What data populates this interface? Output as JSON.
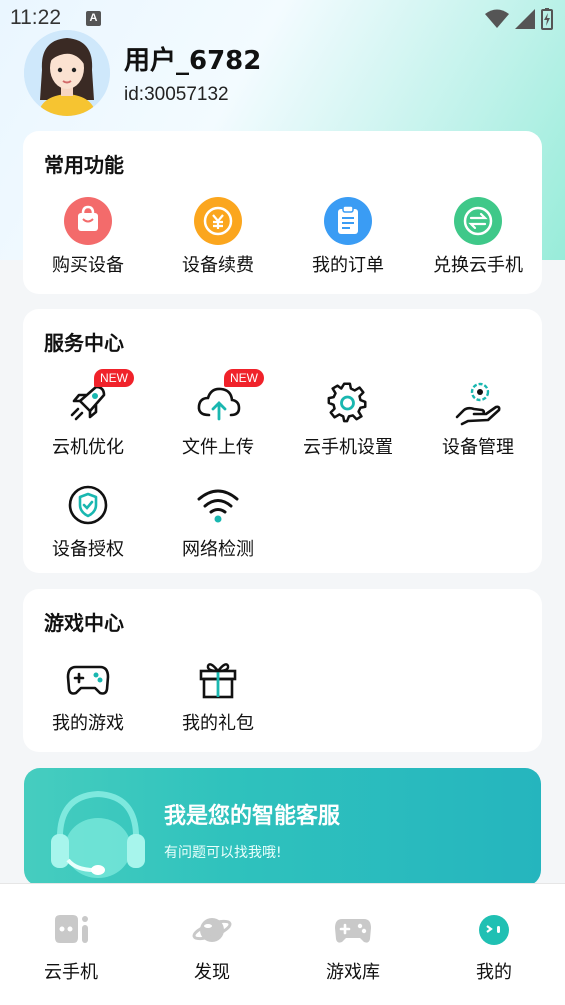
{
  "status_bar": {
    "time": "11:22",
    "notification_letter": "A"
  },
  "profile": {
    "username": "用户_6782",
    "user_id": "id:30057132"
  },
  "common_functions": {
    "title": "常用功能",
    "items": [
      {
        "label": "购买设备",
        "icon": "shopping-bag-icon",
        "color": "#f36b6b"
      },
      {
        "label": "设备续费",
        "icon": "renew-coin-icon",
        "color": "#fba61e"
      },
      {
        "label": "我的订单",
        "icon": "clipboard-order-icon",
        "color": "#3a9cf4"
      },
      {
        "label": "兑换云手机",
        "icon": "exchange-icon",
        "color": "#3fc889"
      }
    ]
  },
  "service_center": {
    "title": "服务中心",
    "new_badge": "NEW",
    "items": [
      {
        "label": "云机优化",
        "icon": "rocket-icon"
      },
      {
        "label": "文件上传",
        "icon": "cloud-upload-icon"
      },
      {
        "label": "云手机设置",
        "icon": "gear-icon"
      },
      {
        "label": "设备管理",
        "icon": "hand-gear-icon"
      },
      {
        "label": "设备授权",
        "icon": "shield-check-icon"
      },
      {
        "label": "网络检测",
        "icon": "wifi-icon"
      }
    ]
  },
  "game_center": {
    "title": "游戏中心",
    "items": [
      {
        "label": "我的游戏",
        "icon": "gamepad-icon"
      },
      {
        "label": "我的礼包",
        "icon": "gift-icon"
      }
    ]
  },
  "customer_service": {
    "title": "我是您的智能客服",
    "subtitle": "有问题可以找我哦!"
  },
  "tabbar": {
    "tabs": [
      {
        "label": "云手机",
        "icon": "cloud-phone-icon",
        "active": false
      },
      {
        "label": "发现",
        "icon": "planet-icon",
        "active": false
      },
      {
        "label": "游戏库",
        "icon": "gamepad-tab-icon",
        "active": false
      },
      {
        "label": "我的",
        "icon": "profile-face-icon",
        "active": true
      }
    ]
  },
  "colors": {
    "accent": "#2cc3b8",
    "badge": "#f0222a",
    "icon_teal": "#19b7b0"
  }
}
